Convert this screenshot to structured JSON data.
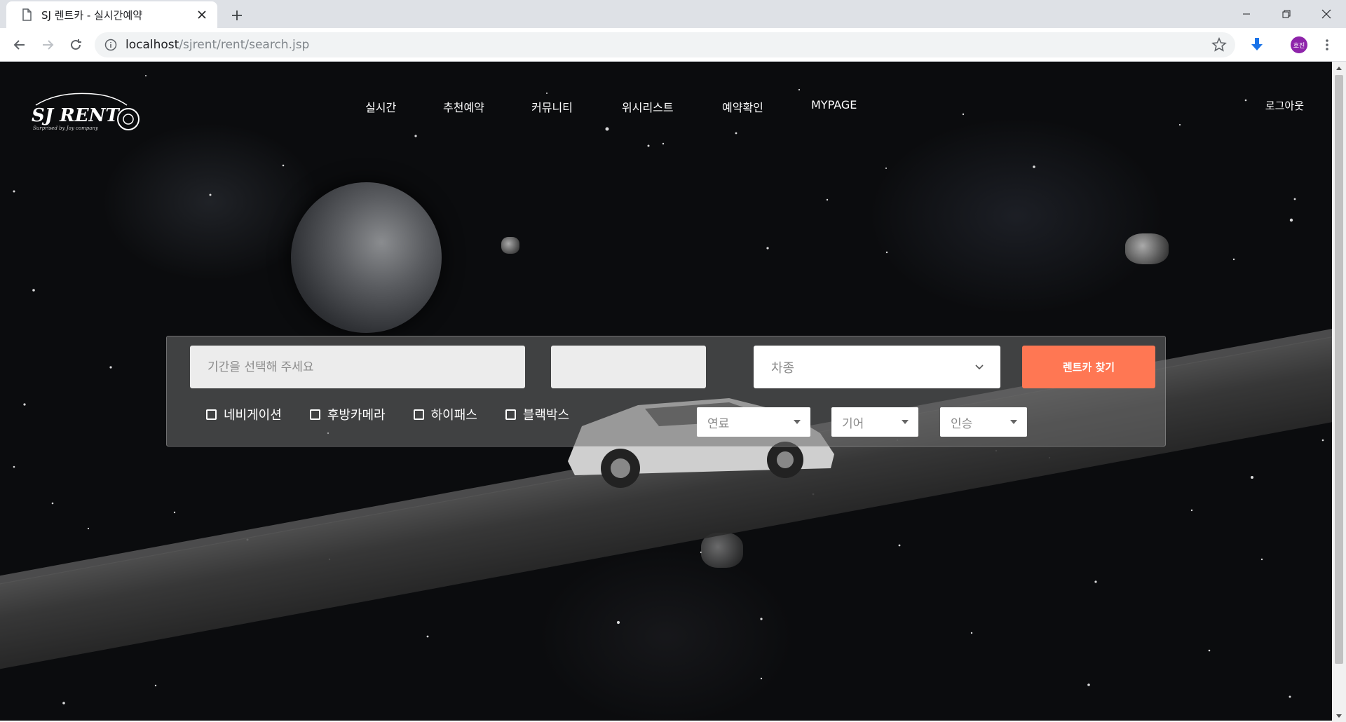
{
  "browser": {
    "tab_title": "SJ 렌트카 - 실시간예약",
    "url_host": "localhost",
    "url_path": "/sjrent/rent/search.jsp",
    "profile_initials": "호진"
  },
  "site": {
    "logo_text": "SJ RENT",
    "logo_tagline": "Surprised by Joy company",
    "nav": [
      "실시간",
      "추천예약",
      "커뮤니티",
      "위시리스트",
      "예약확인",
      "MYPAGE"
    ],
    "logout_label": "로그아웃"
  },
  "search": {
    "period_placeholder": "기간을 선택해 주세요",
    "car_type_placeholder": "차종",
    "find_button": "렌트카 찾기",
    "options": [
      "네비게이션",
      "후방카메라",
      "하이패스",
      "블랙박스"
    ],
    "fuel_placeholder": "연료",
    "gear_placeholder": "기어",
    "seats_placeholder": "인승"
  },
  "colors": {
    "accent": "#ff7753",
    "tabstrip": "#dee1e6",
    "profile": "#8e24aa"
  }
}
